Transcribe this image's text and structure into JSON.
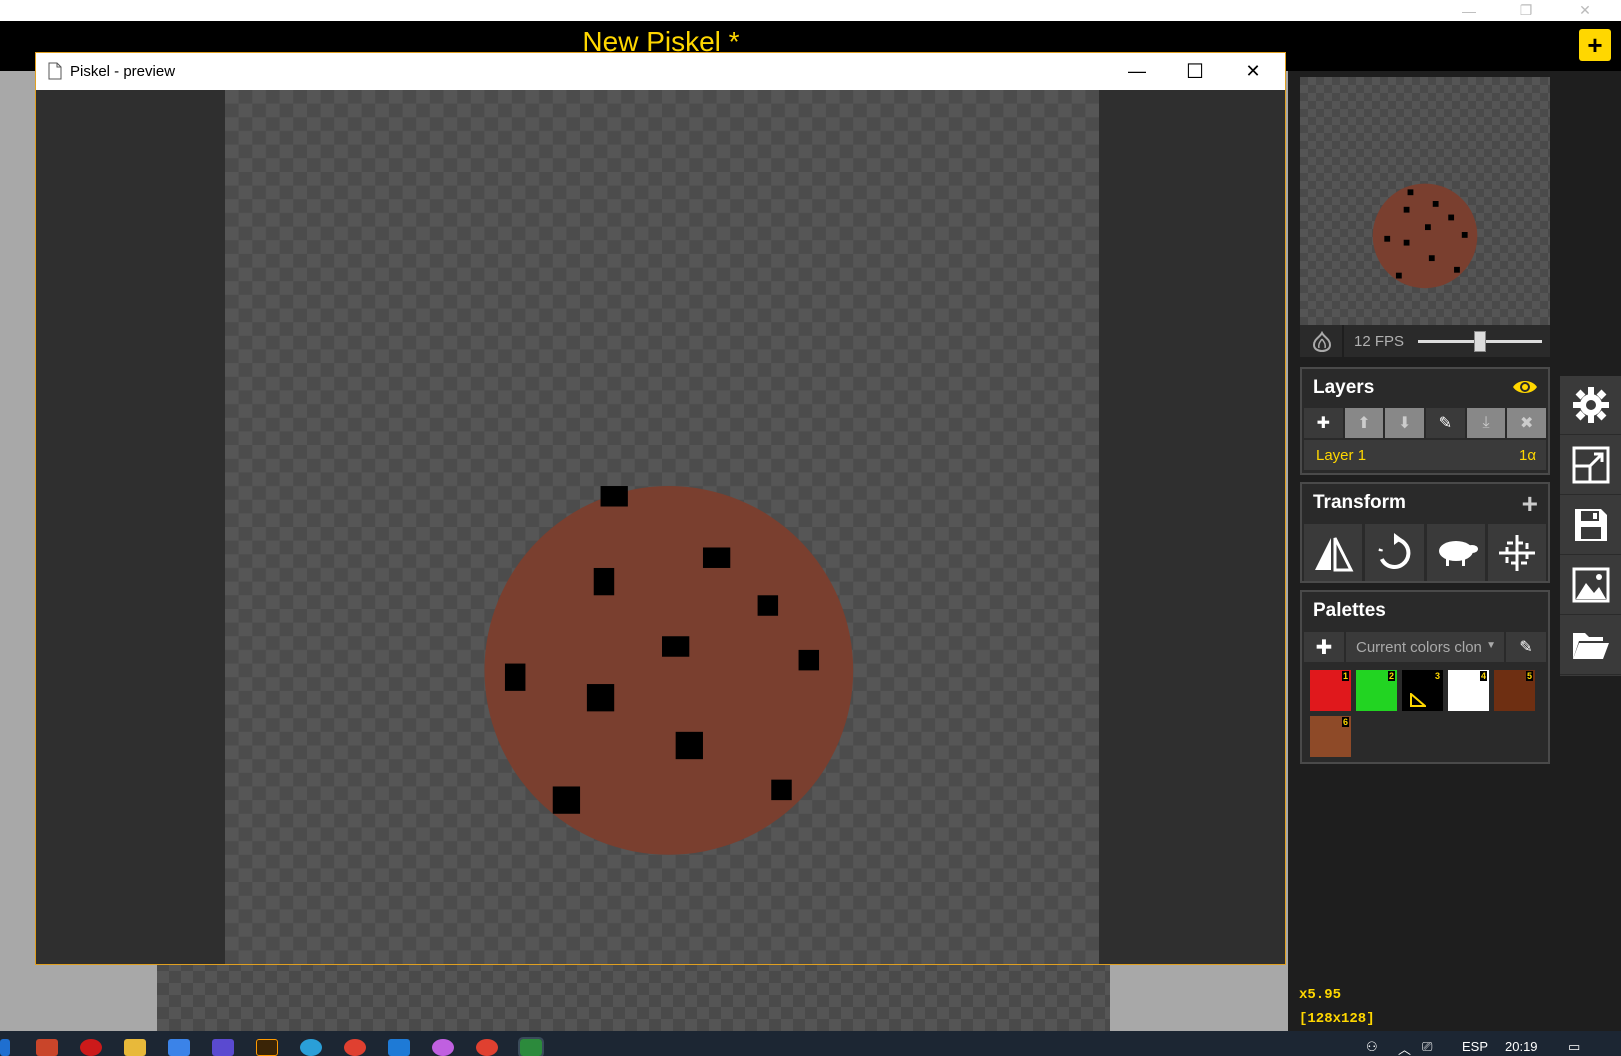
{
  "app": {
    "title": "New Piskel *",
    "new_button": "+"
  },
  "outer_controls": [
    "—",
    "❐",
    "✕"
  ],
  "preview_window": {
    "title": "Piskel - preview",
    "controls": {
      "minimize": "—",
      "maximize": "☐",
      "close": "✕"
    }
  },
  "animation": {
    "fps_label": "12 FPS",
    "fps_value": 12
  },
  "layers": {
    "title": "Layers",
    "toolbar": [
      "add",
      "move-up",
      "move-down",
      "edit",
      "merge",
      "delete"
    ],
    "items": [
      {
        "name": "Layer 1",
        "alpha": "1α"
      }
    ]
  },
  "transform": {
    "title": "Transform",
    "tools": [
      "flip",
      "rotate",
      "clone",
      "center"
    ]
  },
  "palettes": {
    "title": "Palettes",
    "selected": "Current colors clon",
    "swatches": [
      {
        "num": "1",
        "color": "#e0181c"
      },
      {
        "num": "2",
        "color": "#22d422"
      },
      {
        "num": "3",
        "color": "#000000"
      },
      {
        "num": "4",
        "color": "#ffffff"
      },
      {
        "num": "5",
        "color": "#6e2f12"
      },
      {
        "num": "6",
        "color": "#8e4a28"
      }
    ]
  },
  "side_tools": [
    "settings",
    "resize",
    "save",
    "export",
    "import"
  ],
  "status": {
    "zoom": "x5.95",
    "size": "[128x128]"
  },
  "taskbar": {
    "lang": "ESP",
    "time": "20:19"
  },
  "colors": {
    "accent": "#ffd700",
    "cookie": "#7a3f2f",
    "chip": "#000000"
  }
}
